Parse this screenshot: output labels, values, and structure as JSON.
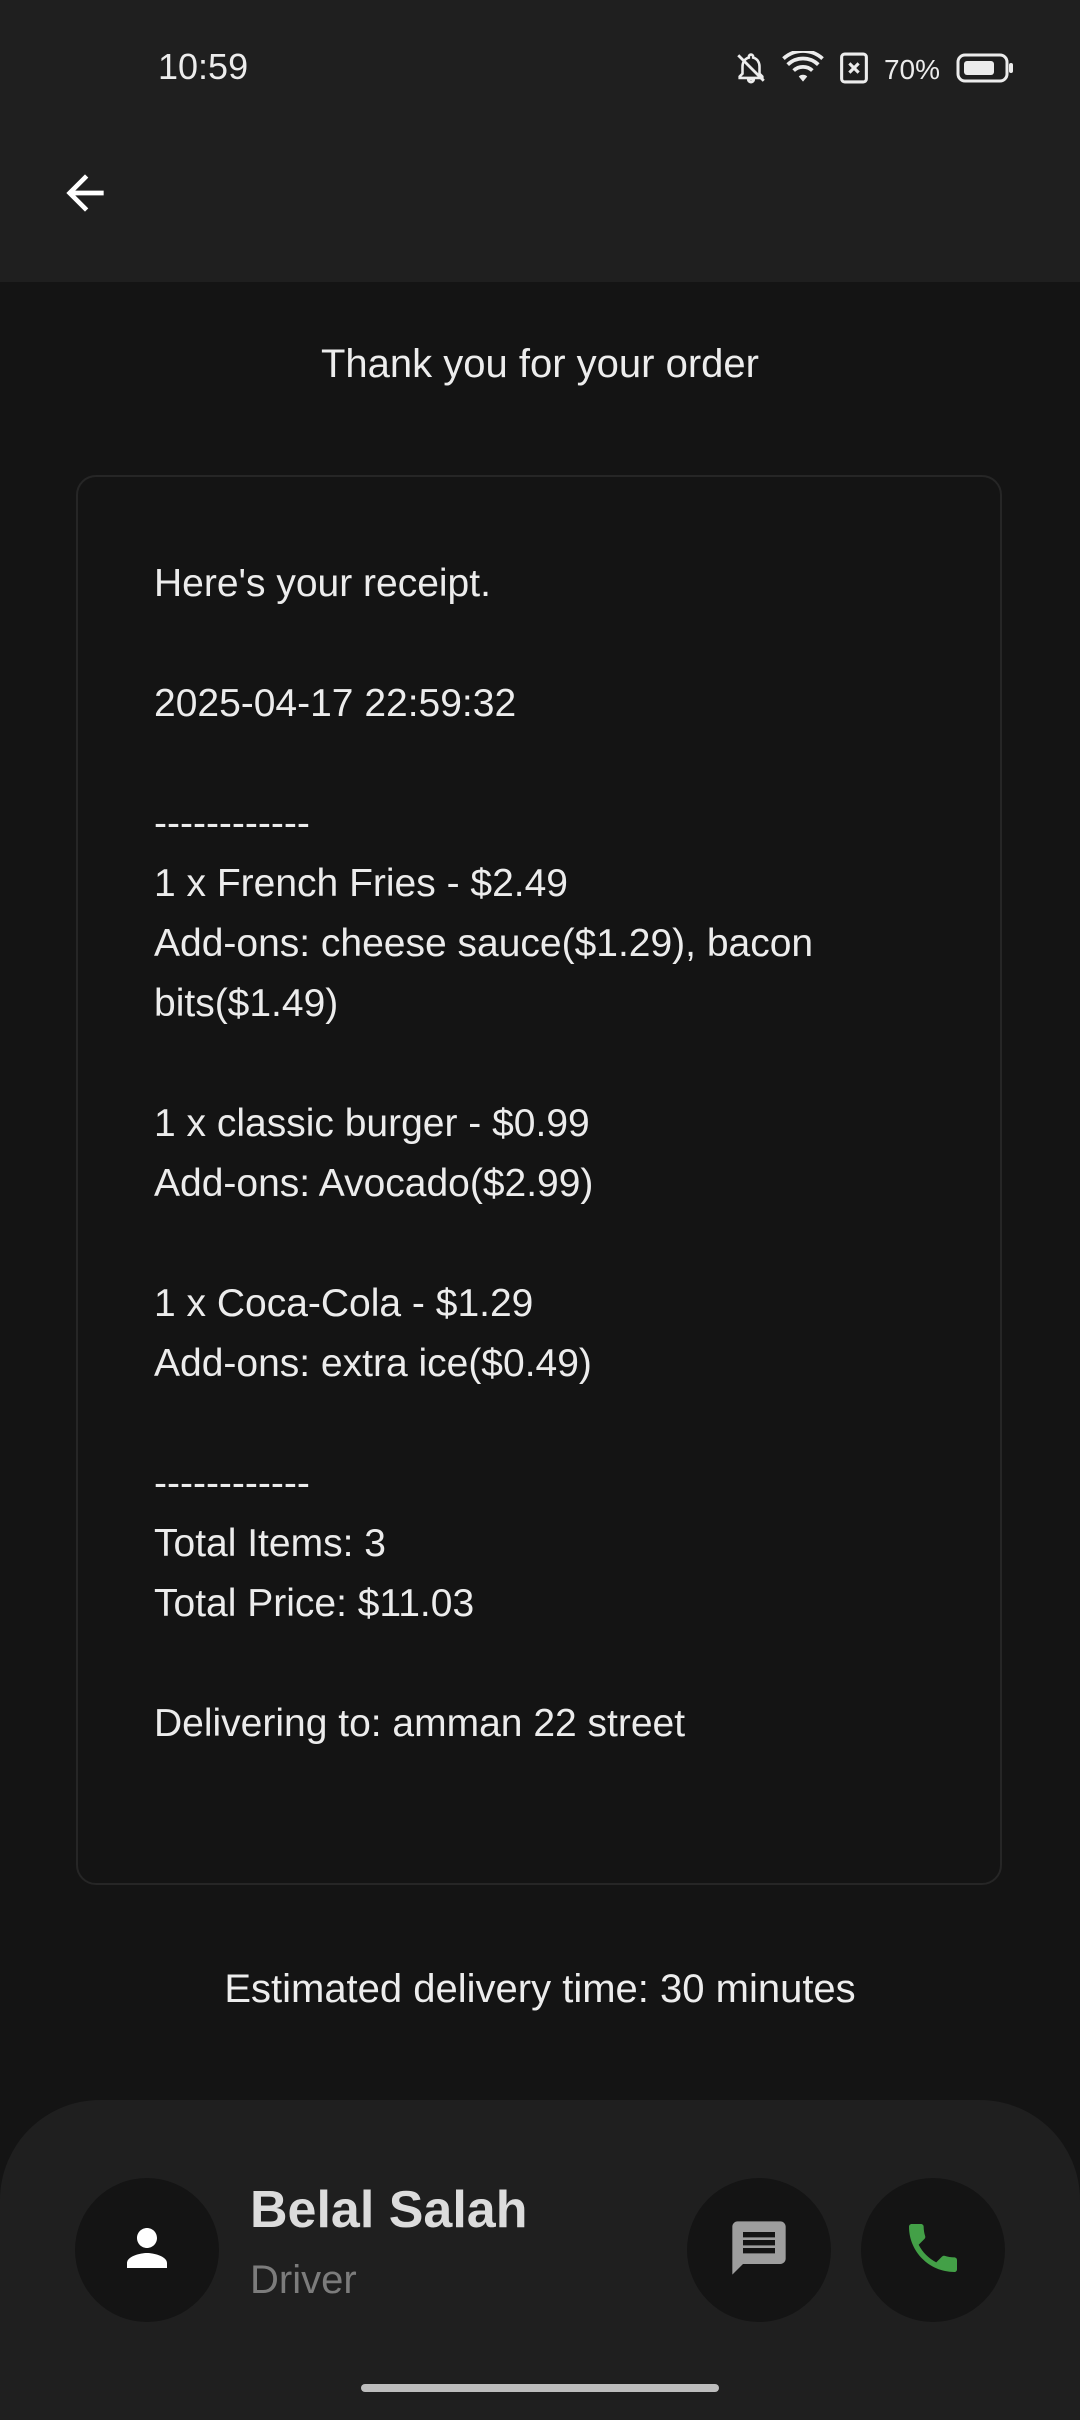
{
  "status_bar": {
    "time": "10:59",
    "battery": "70%",
    "icons": [
      "bell-off-icon",
      "wifi-icon",
      "sim-x-icon",
      "battery-icon"
    ]
  },
  "app_bar": {
    "back_icon": "arrow-left-icon"
  },
  "order": {
    "thanks": "Thank you for your order",
    "receipt": "Here's your receipt.\n\n2025-04-17 22:59:32\n\n------------\n1 x French Fries - $2.49\nAdd-ons: cheese sauce($1.29), bacon bits($1.49)\n\n1 x classic burger - $0.99\nAdd-ons: Avocado($2.99)\n\n1 x Coca-Cola - $1.29\nAdd-ons: extra ice($0.49)\n\n------------\nTotal Items: 3\nTotal Price: $11.03\n\nDelivering to: amman 22 street",
    "eta": "Estimated delivery time: 30 minutes"
  },
  "driver": {
    "name": "Belal Salah",
    "role": "Driver",
    "avatar_icon": "person-icon",
    "chat_icon": "chat-icon",
    "call_icon": "phone-icon"
  },
  "colors": {
    "background": "#141414",
    "surface": "#1f1f1f",
    "text": "#ececec",
    "call_green": "#43a047"
  }
}
